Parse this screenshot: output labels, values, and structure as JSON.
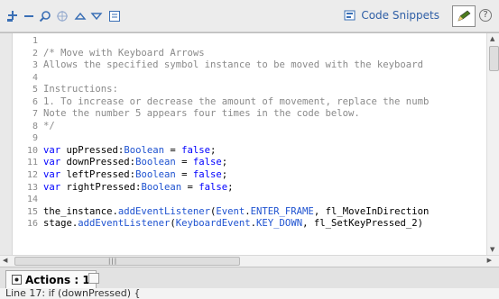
{
  "toolbar": {
    "code_snippets_label": "Code Snippets",
    "help_label": "?"
  },
  "code_lines": [
    {
      "n": "1",
      "tokens": []
    },
    {
      "n": "2",
      "tokens": [
        {
          "c": "cm",
          "t": "/* Move with Keyboard Arrows"
        }
      ]
    },
    {
      "n": "3",
      "tokens": [
        {
          "c": "cm",
          "t": "Allows the specified symbol instance to be moved with the keyboard"
        }
      ]
    },
    {
      "n": "4",
      "tokens": []
    },
    {
      "n": "5",
      "tokens": [
        {
          "c": "cm",
          "t": "Instructions:"
        }
      ]
    },
    {
      "n": "6",
      "tokens": [
        {
          "c": "cm",
          "t": "1. To increase or decrease the amount of movement, replace the numb"
        }
      ]
    },
    {
      "n": "7",
      "tokens": [
        {
          "c": "cm",
          "t": "Note the number 5 appears four times in the code below."
        }
      ]
    },
    {
      "n": "8",
      "tokens": [
        {
          "c": "cm",
          "t": "*/"
        }
      ]
    },
    {
      "n": "9",
      "tokens": []
    },
    {
      "n": "10",
      "tokens": [
        {
          "c": "kw",
          "t": "var"
        },
        {
          "c": "",
          "t": " upPressed:"
        },
        {
          "c": "ty",
          "t": "Boolean"
        },
        {
          "c": "",
          "t": " = "
        },
        {
          "c": "kw",
          "t": "false"
        },
        {
          "c": "",
          "t": ";"
        }
      ]
    },
    {
      "n": "11",
      "tokens": [
        {
          "c": "kw",
          "t": "var"
        },
        {
          "c": "",
          "t": " downPressed:"
        },
        {
          "c": "ty",
          "t": "Boolean"
        },
        {
          "c": "",
          "t": " = "
        },
        {
          "c": "kw",
          "t": "false"
        },
        {
          "c": "",
          "t": ";"
        }
      ]
    },
    {
      "n": "12",
      "tokens": [
        {
          "c": "kw",
          "t": "var"
        },
        {
          "c": "",
          "t": " leftPressed:"
        },
        {
          "c": "ty",
          "t": "Boolean"
        },
        {
          "c": "",
          "t": " = "
        },
        {
          "c": "kw",
          "t": "false"
        },
        {
          "c": "",
          "t": ";"
        }
      ]
    },
    {
      "n": "13",
      "tokens": [
        {
          "c": "kw",
          "t": "var"
        },
        {
          "c": "",
          "t": " rightPressed:"
        },
        {
          "c": "ty",
          "t": "Boolean"
        },
        {
          "c": "",
          "t": " = "
        },
        {
          "c": "kw",
          "t": "false"
        },
        {
          "c": "",
          "t": ";"
        }
      ]
    },
    {
      "n": "14",
      "tokens": []
    },
    {
      "n": "15",
      "tokens": [
        {
          "c": "",
          "t": "the_instance."
        },
        {
          "c": "fn",
          "t": "addEventListener"
        },
        {
          "c": "",
          "t": "("
        },
        {
          "c": "ty",
          "t": "Event"
        },
        {
          "c": "",
          "t": "."
        },
        {
          "c": "ty",
          "t": "ENTER_FRAME"
        },
        {
          "c": "",
          "t": ", fl_MoveInDirection"
        }
      ]
    },
    {
      "n": "16",
      "tokens": [
        {
          "c": "",
          "t": "stage."
        },
        {
          "c": "fn",
          "t": "addEventListener"
        },
        {
          "c": "",
          "t": "("
        },
        {
          "c": "ty",
          "t": "KeyboardEvent"
        },
        {
          "c": "",
          "t": "."
        },
        {
          "c": "ty",
          "t": "KEY_DOWN"
        },
        {
          "c": "",
          "t": ", fl_SetKeyPressed_2)"
        }
      ]
    }
  ],
  "tabs": {
    "actions_label": "Actions : 1"
  },
  "status": {
    "text": "Line 17: if (downPressed) {"
  },
  "colors": {
    "keyword": "#0000ff",
    "type": "#1e52d0",
    "comment": "#8a8a8a"
  }
}
